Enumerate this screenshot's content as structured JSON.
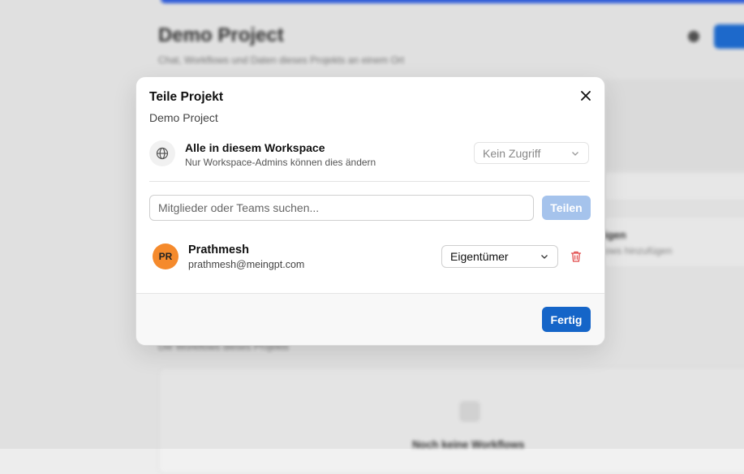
{
  "background": {
    "title": "Demo Project",
    "subtitle": "Chat, Workflows und Daten dieses Projekts an einem Ort",
    "card_title": "igen",
    "card_subtitle": "ows hinzufügen",
    "section_label": "Die Workflows dieses Projekts",
    "empty_title": "Noch keine Workflows"
  },
  "modal": {
    "title": "Teile Projekt",
    "subtitle": "Demo Project",
    "workspace": {
      "icon": "globe-icon",
      "title": "Alle in diesem Workspace",
      "description": "Nur Workspace-Admins können dies ändern",
      "access_value": "Kein Zugriff"
    },
    "search": {
      "placeholder": "Mitglieder oder Teams suchen...",
      "value": ""
    },
    "share_button": "Teilen",
    "members": [
      {
        "initials": "PR",
        "name": "Prathmesh",
        "email": "prathmesh@meingpt.com",
        "role": "Eigentümer",
        "avatar_color": "#f58a2c"
      }
    ],
    "done_button": "Fertig"
  },
  "colors": {
    "primary": "#1565c8",
    "primary_disabled": "#a5c3ec",
    "danger": "#e04848",
    "accent_bar": "#2f5fe3"
  }
}
